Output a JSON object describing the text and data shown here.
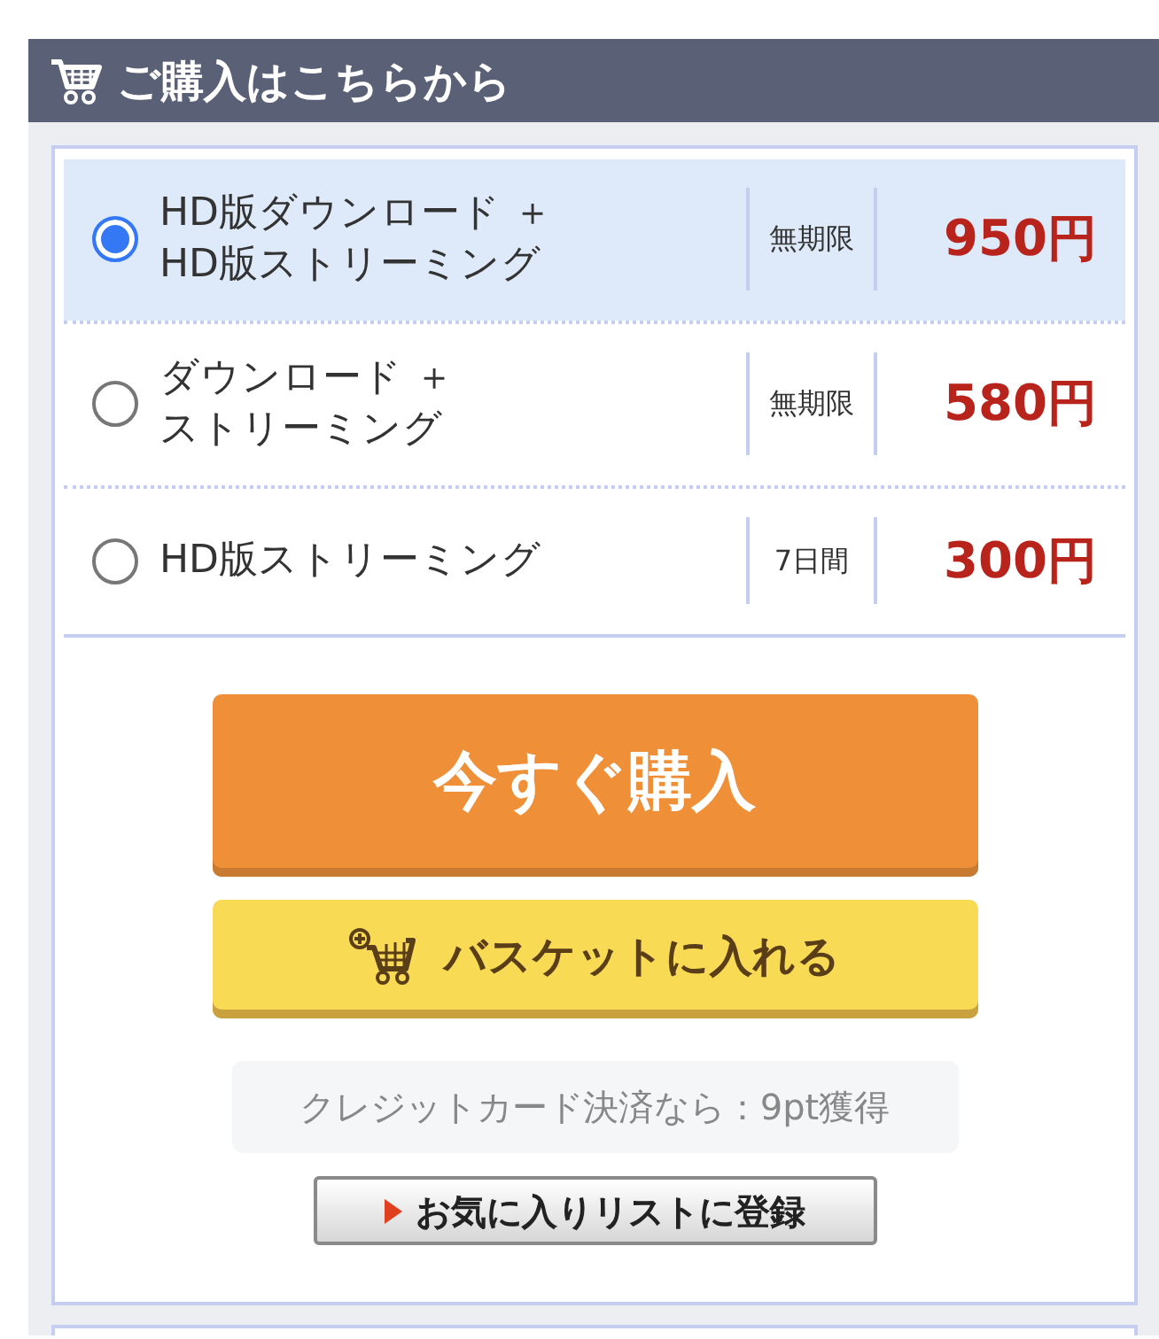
{
  "section": {
    "title": "ご購入はこちらから"
  },
  "options": [
    {
      "label_lines": [
        "HD版ダウンロード ＋",
        "HD版ストリーミング"
      ],
      "period": "無期限",
      "price": "950円",
      "selected": true
    },
    {
      "label_lines": [
        "ダウンロード ＋",
        "ストリーミング"
      ],
      "period": "無期限",
      "price": "580円",
      "selected": false
    },
    {
      "label_lines": [
        "HD版ストリーミング"
      ],
      "period": "7日間",
      "price": "300円",
      "selected": false
    }
  ],
  "buy_button": "今すぐ購入",
  "basket_button": "バスケットに入れる",
  "points_note": "クレジットカード決済なら：9pt獲得",
  "favorite_button": "お気に入りリストに登録"
}
